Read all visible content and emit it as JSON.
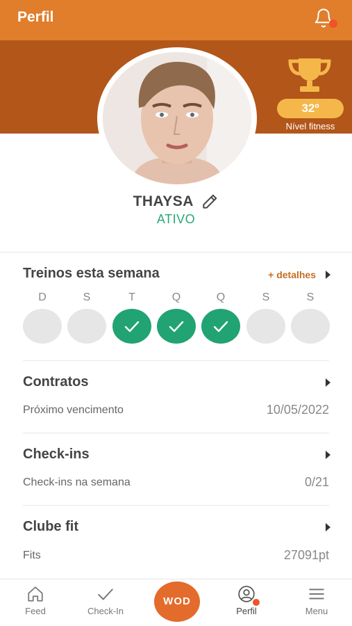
{
  "header": {
    "title": "Perfil"
  },
  "profile": {
    "name": "THAYSA",
    "status": "ATIVO",
    "level_value": "32º",
    "level_label": "Nível fitness"
  },
  "week": {
    "title": "Treinos esta semana",
    "details_link": "+ detalhes",
    "days": [
      {
        "letter": "D",
        "done": false
      },
      {
        "letter": "S",
        "done": false
      },
      {
        "letter": "T",
        "done": true
      },
      {
        "letter": "Q",
        "done": true
      },
      {
        "letter": "Q",
        "done": true
      },
      {
        "letter": "S",
        "done": false
      },
      {
        "letter": "S",
        "done": false
      }
    ]
  },
  "contracts": {
    "title": "Contratos",
    "label": "Próximo vencimento",
    "value": "10/05/2022"
  },
  "checkins": {
    "title": "Check-ins",
    "label": "Check-ins na semana",
    "value": "0/21"
  },
  "club": {
    "title": "Clube fit",
    "label": "Fits",
    "value": "27091pt"
  },
  "nav": {
    "feed": "Feed",
    "checkin": "Check-In",
    "wod": "WOD",
    "perfil": "Perfil",
    "menu": "Menu"
  },
  "colors": {
    "header": "#e07e2c",
    "banner": "#b2561a",
    "accent_green": "#21a374",
    "badge": "#f5b74a",
    "notification_dot": "#f0522a"
  }
}
